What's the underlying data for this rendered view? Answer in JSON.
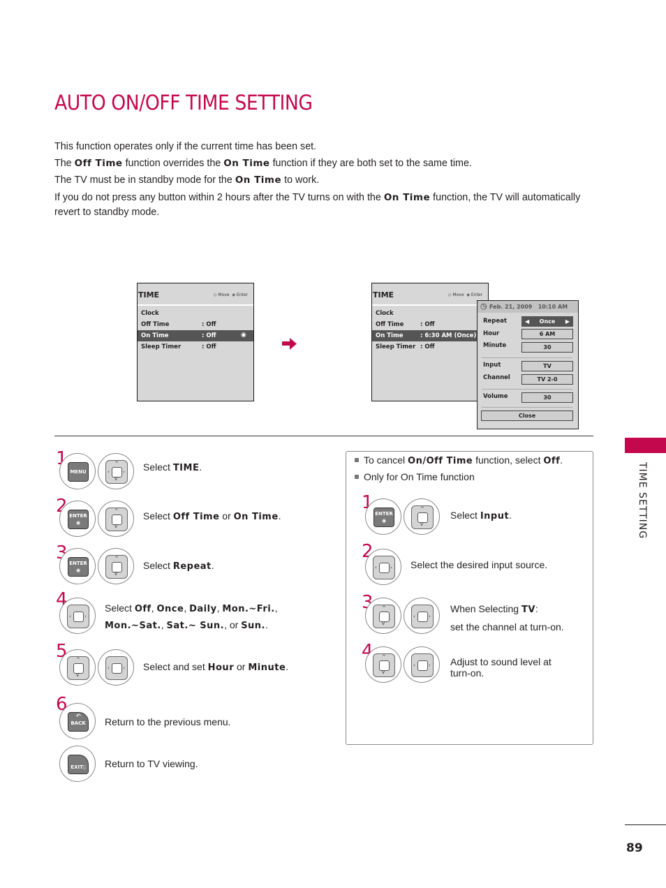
{
  "page": {
    "title": "AUTO ON/OFF TIME SETTING",
    "section_tab": "TIME SETTING",
    "page_number": "89",
    "accent_color": "#c4084e"
  },
  "intro": {
    "line1": "This function operates only if the current time has been set.",
    "line2": {
      "pre": "The ",
      "b1": "Off Time",
      "mid": " function overrides the ",
      "b2": "On Time",
      "post": " function if they are both set to the same time."
    },
    "line3": {
      "pre": "The TV must be in standby mode for the ",
      "b1": "On Time",
      "post": " to work."
    },
    "line4": {
      "pre": "If you do not press any button within 2 hours after the TV turns on with the ",
      "b1": "On Time",
      "post": " function, the TV will automatically revert to standby mode."
    }
  },
  "screen1": {
    "title": "TIME",
    "hint_move": "Move",
    "hint_enter": "Enter",
    "rows": [
      {
        "label": "Clock",
        "value": ""
      },
      {
        "label": "Off Time",
        "value": ": Off"
      },
      {
        "label": "On Time",
        "value": ": Off",
        "selected": true
      },
      {
        "label": "Sleep Timer",
        "value": ": Off"
      }
    ]
  },
  "screen2": {
    "title": "TIME",
    "hint_move": "Move",
    "hint_enter": "Enter",
    "rows": [
      {
        "label": "Clock",
        "value": ""
      },
      {
        "label": "Off Time",
        "value": ": Off"
      },
      {
        "label": "On Time",
        "value": ": 6:30 AM (Once)",
        "selected": true
      },
      {
        "label": "Sleep Timer",
        "value": ": Off"
      }
    ],
    "popup": {
      "datetime": "Feb. 21, 2009   10:10 AM",
      "repeat_label": "Repeat",
      "repeat_value": "Once",
      "hour_label": "Hour",
      "hour_value": "6 AM",
      "minute_label": "Minute",
      "minute_value": "30",
      "input_label": "Input",
      "input_value": "TV",
      "channel_label": "Channel",
      "channel_value": "TV 2-0",
      "volume_label": "Volume",
      "volume_value": "30",
      "close_label": "Close"
    }
  },
  "steps_left": [
    {
      "num": "1",
      "buttons": [
        "MENU",
        "pad-4way"
      ],
      "text": {
        "pre": "Select ",
        "b1": "TIME",
        "post": "."
      }
    },
    {
      "num": "2",
      "buttons": [
        "ENTER",
        "pad-updown"
      ],
      "text": {
        "pre": "Select ",
        "b1": "Off Time",
        "mid": " or ",
        "b2": "On Time",
        "post": "."
      }
    },
    {
      "num": "3",
      "buttons": [
        "ENTER",
        "pad-updown"
      ],
      "text": {
        "pre": "Select ",
        "b1": "Repeat",
        "post": "."
      }
    },
    {
      "num": "4",
      "buttons": [
        "pad-leftright"
      ],
      "text": {
        "pre": "Select ",
        "b1": "Off",
        "s1": ", ",
        "b2": "Once",
        "s2": ", ",
        "b3": "Daily",
        "s3": ", ",
        "b4": "Mon.~Fri.",
        "s4": ",",
        "b5": "Mon.~Sat.",
        "s5": ", ",
        "b6": "Sat.~ Sun.",
        "s6": ", or ",
        "b7": "Sun.",
        "post": "."
      }
    },
    {
      "num": "5",
      "buttons": [
        "pad-updown",
        "pad-leftright"
      ],
      "text": {
        "pre": "Select and set ",
        "b1": "Hour",
        "mid": " or ",
        "b2": "Minute",
        "post": "."
      }
    },
    {
      "num": "6",
      "buttons": [
        "BACK"
      ],
      "text": {
        "pre": "Return to the previous menu."
      }
    },
    {
      "num": "",
      "buttons": [
        "EXIT"
      ],
      "text": {
        "pre": "Return to TV viewing."
      }
    }
  ],
  "notes": {
    "bullet1": {
      "pre": "To cancel ",
      "b1": "On/Off Time",
      "mid": " function, select ",
      "b2": "Off",
      "post": "."
    },
    "bullet2": "Only for On Time function",
    "steps": [
      {
        "num": "1",
        "text": {
          "pre": "Select ",
          "b1": "Input",
          "post": "."
        }
      },
      {
        "num": "2",
        "text": {
          "pre": "Select the desired input source."
        }
      },
      {
        "num": "3",
        "text": {
          "pre": "When Selecting ",
          "b1": "TV",
          "post": ":",
          "line2": "set the channel at turn-on."
        }
      },
      {
        "num": "4",
        "text": {
          "pre": "Adjust to sound level at",
          "line2": "turn-on."
        }
      }
    ]
  },
  "button_labels": {
    "menu": "MENU",
    "enter": "ENTER",
    "back": "BACK",
    "exit": "EXIT"
  }
}
